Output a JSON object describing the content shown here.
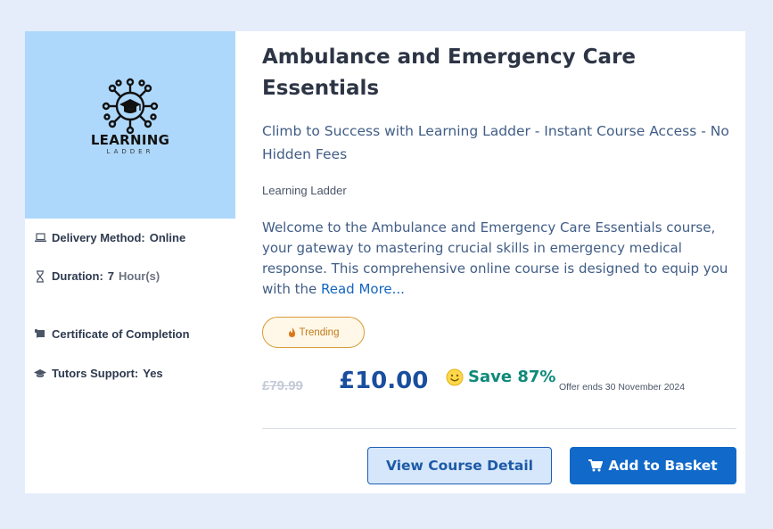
{
  "course": {
    "title": "Ambulance and Emergency Care Essentials",
    "subtitle": "Climb to Success with Learning Ladder - Instant Course Access - No Hidden Fees",
    "provider": "Learning Ladder",
    "description": "Welcome to the Ambulance and Emergency Care Essentials course, your gateway to mastering crucial skills in emergency medical response. This comprehensive online course is designed to equip you with the",
    "read_more": "Read More...",
    "badge": "Trending"
  },
  "logo": {
    "word": "LEARNING",
    "sub": "LADDER",
    "icon": "graduation-cap-network-icon"
  },
  "meta": {
    "delivery_label": "Delivery Method:",
    "delivery_value": "Online",
    "duration_label": "Duration:",
    "duration_value": "7",
    "duration_unit": "Hour(s)",
    "certificate_label": "Certificate of Completion",
    "tutor_label": "Tutors Support:",
    "tutor_value": "Yes"
  },
  "pricing": {
    "old_price": "£79.99",
    "price": "£10.00",
    "save_text": "Save 87%",
    "offer_text": "Offer ends 30 November 2024"
  },
  "actions": {
    "view_detail": "View Course Detail",
    "add_basket": "Add to Basket"
  },
  "colors": {
    "page_bg": "#e5edfa",
    "thumb_bg": "#aed8fb",
    "price": "#1a4e9e",
    "save": "#0f8a7a",
    "primary_button": "#1169c9"
  }
}
